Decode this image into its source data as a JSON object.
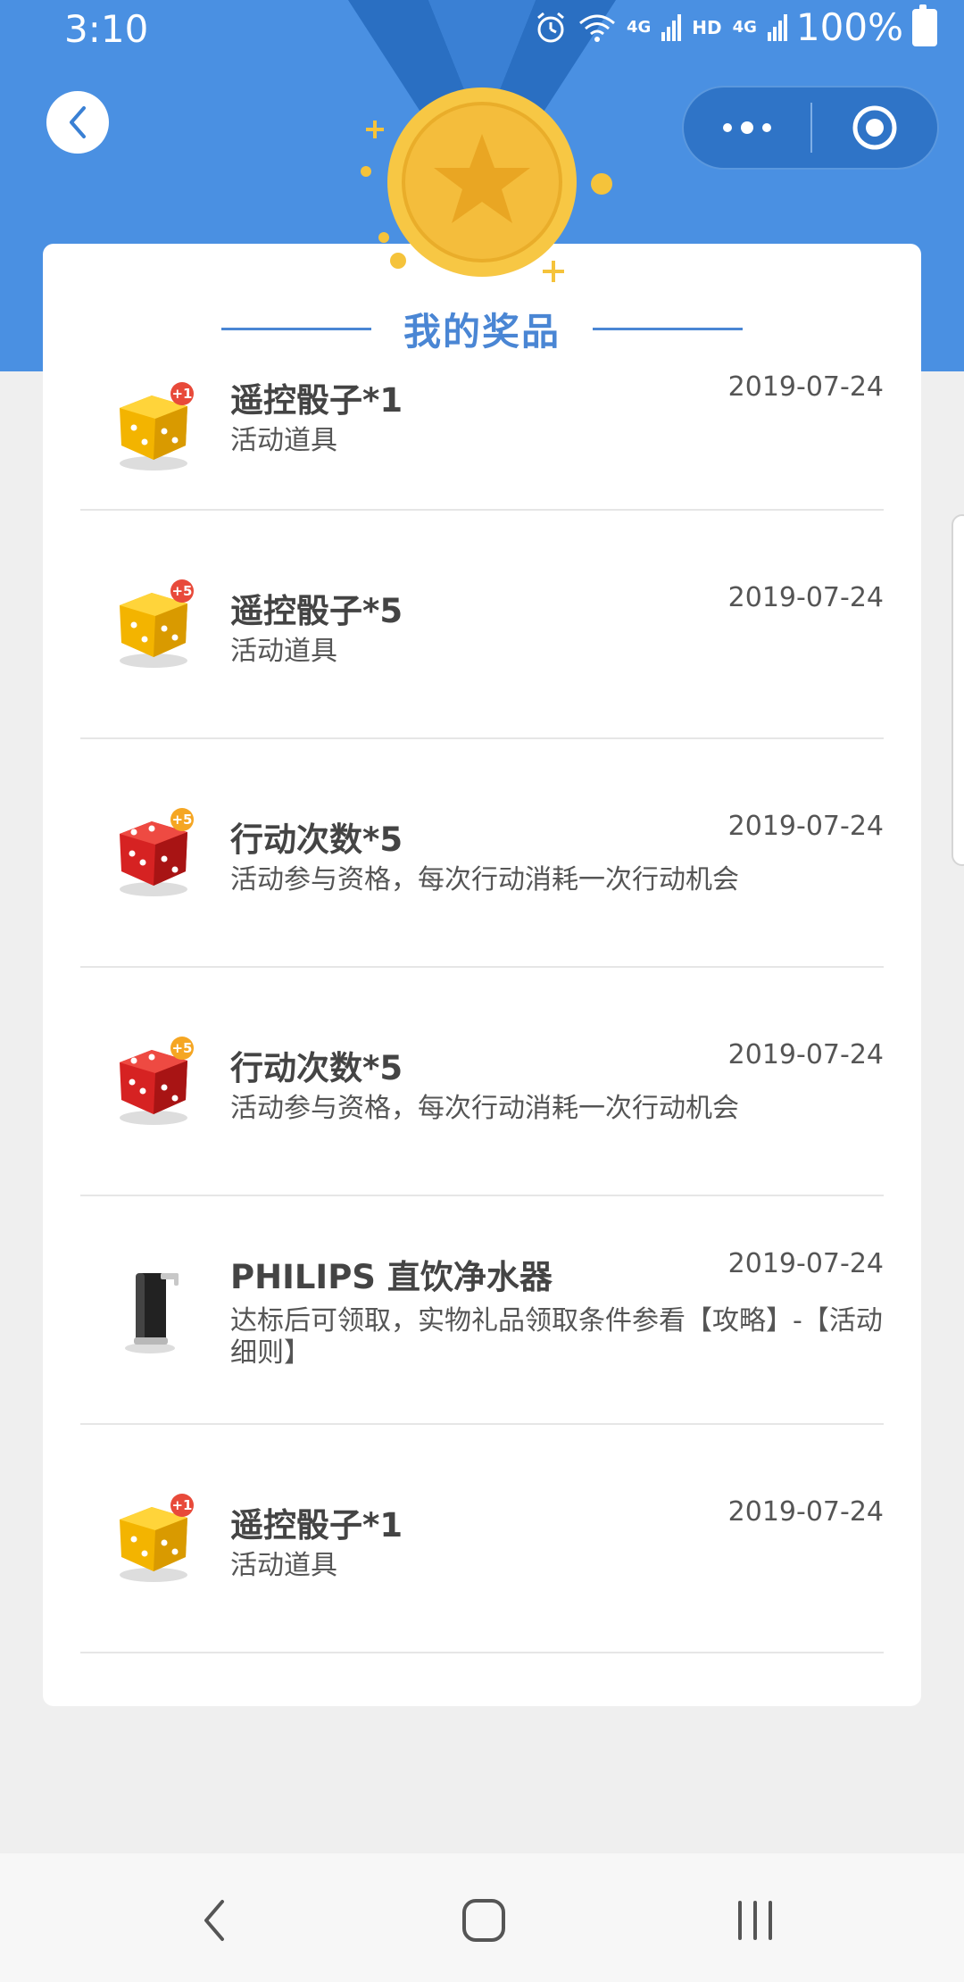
{
  "status_bar": {
    "time": "3:10",
    "network_1": "4G",
    "hd": "HD",
    "network_2": "4G",
    "battery": "100%"
  },
  "header": {
    "title": "我的奖品"
  },
  "prizes": [
    {
      "icon": "dice-gold-plus1-icon",
      "name": "遥控骰子*1",
      "desc": "活动道具",
      "date": "2019-07-24"
    },
    {
      "icon": "dice-gold-plus5-icon",
      "name": "遥控骰子*5",
      "desc": "活动道具",
      "date": "2019-07-24"
    },
    {
      "icon": "dice-red-plus5-icon",
      "name": "行动次数*5",
      "desc": "活动参与资格，每次行动消耗一次行动机会",
      "date": "2019-07-24"
    },
    {
      "icon": "dice-red-plus5-icon",
      "name": "行动次数*5",
      "desc": "活动参与资格，每次行动消耗一次行动机会",
      "date": "2019-07-24"
    },
    {
      "icon": "water-purifier-icon",
      "name": "PHILIPS 直饮净水器",
      "desc": "达标后可领取，实物礼品领取条件参看【攻略】-【活动细则】",
      "date": "2019-07-24"
    },
    {
      "icon": "dice-gold-plus1-icon",
      "name": "遥控骰子*1",
      "desc": "活动道具",
      "date": "2019-07-24"
    }
  ],
  "badges": {
    "plus1": "+1",
    "plus5": "+5"
  },
  "colors": {
    "header_blue": "#4a90e2",
    "title_blue": "#4a86d4",
    "gold": "#f5b800",
    "red": "#d62222"
  }
}
